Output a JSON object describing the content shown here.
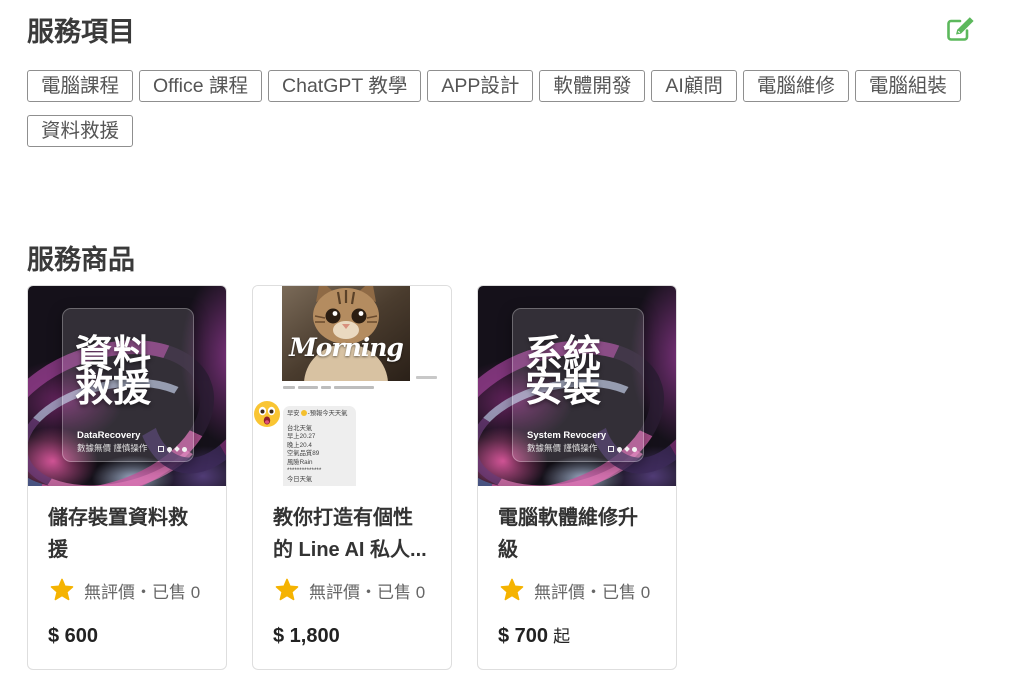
{
  "services": {
    "title": "服務項目",
    "edit_icon": "edit-icon",
    "accent_color": "#5cb85c",
    "tags": [
      "電腦課程",
      "Office 課程",
      "ChatGPT 教學",
      "APP設計",
      "軟體開發",
      "AI顧問",
      "電腦維修",
      "電腦組裝",
      "資料救援"
    ]
  },
  "products": {
    "title": "服務商品",
    "rating_icon": "star-icon",
    "rating_color": "#f5b301",
    "items": [
      {
        "title": "儲存裝置資料救援",
        "rating_text": "無評價・已售 0",
        "price": "$ 600",
        "image": {
          "heading_lines": [
            "資料",
            "救援"
          ],
          "subtitle": "DataRecovery",
          "tagline": "數據無價 謹慎操作"
        }
      },
      {
        "title": "教你打造有個性的 Line AI 私人...",
        "rating_text": "無評價・已售 0",
        "price": "$ 1,800",
        "image": {
          "photo_caption": "Morning",
          "reaction_icon": "shocked-emoji-icon",
          "chat_header": [
            "早安",
            "-預報今天天氣"
          ],
          "chat_lines": [
            "台北天氣",
            "早上20.27",
            "晚上20.4",
            "空氣品質89",
            "風險Rain",
            "**************",
            "今日天氣"
          ]
        }
      },
      {
        "title": "電腦軟體維修升級",
        "rating_text": "無評價・已售 0",
        "price": "$ 700",
        "price_suffix": "起",
        "image": {
          "heading_lines": [
            "系統",
            "安裝"
          ],
          "subtitle": "System Revocery",
          "tagline": "數據無價 謹慎操作"
        }
      }
    ]
  }
}
